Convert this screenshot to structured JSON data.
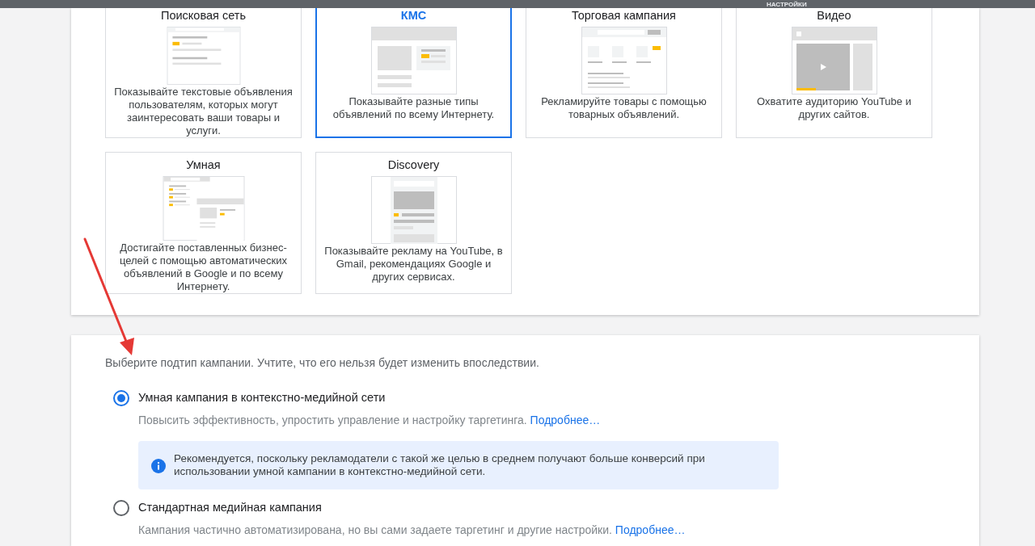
{
  "top_bar": {
    "label": "НАСТРОЙКИ"
  },
  "campaign_types": [
    {
      "kind": "search",
      "title": "Поисковая сеть",
      "description": "Показывайте текстовые объявления пользователям, которых могут заинтересовать ваши товары и услуги.",
      "selected": false
    },
    {
      "kind": "display",
      "title": "КМС",
      "description": "Показывайте разные типы объявлений по всему Интернету.",
      "selected": true
    },
    {
      "kind": "shopping",
      "title": "Торговая кампания",
      "description": "Рекламируйте товары с помощью товарных объявлений.",
      "selected": false
    },
    {
      "kind": "video",
      "title": "Видео",
      "description": "Охватите аудиторию YouTube и других сайтов.",
      "selected": false
    },
    {
      "kind": "smart",
      "title": "Умная",
      "description": "Достигайте поставленных бизнес-целей с помощью автоматических объявлений в Google и по всему Интернету.",
      "selected": false
    },
    {
      "kind": "discovery",
      "title": "Discovery",
      "description": "Показывайте рекламу на YouTube, в Gmail, рекомендациях Google и других сервисах.",
      "selected": false
    }
  ],
  "subtype": {
    "prompt": "Выберите подтип кампании. Учтите, что его нельзя будет изменить впоследствии.",
    "options": [
      {
        "label": "Умная кампания в контекстно-медийной сети",
        "description": "Повысить эффективность, упростить управление и настройку таргетинга.",
        "link": "Подробнее…",
        "selected": true,
        "note": "Рекомендуется, поскольку рекламодатели с такой же целью в среднем получают больше конверсий при использовании умной кампании в контекстно-медийной сети."
      },
      {
        "label": "Стандартная медийная кампания",
        "description": "Кампания частично автоматизирована, но вы сами задаете таргетинг и другие настройки.",
        "link": "Подробнее…",
        "selected": false
      }
    ]
  }
}
